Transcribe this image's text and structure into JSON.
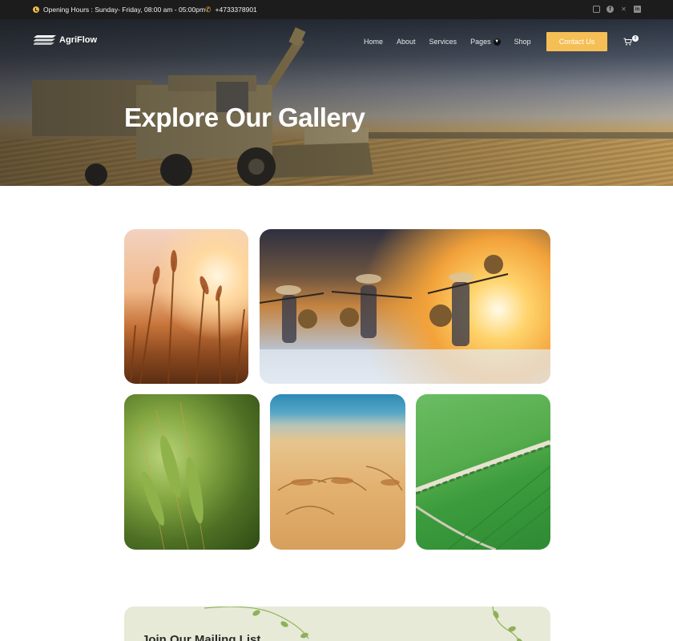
{
  "topbar": {
    "hours_icon": "clock-icon",
    "hours": "Opening Hours : Sunday- Friday, 08:00 am - 05:00pm",
    "phone_icon": "phone-icon",
    "phone": "+4733378901",
    "socials": [
      "instagram-icon",
      "facebook-icon",
      "x-icon",
      "linkedin-icon"
    ]
  },
  "nav": {
    "logo": "AgriFlow",
    "menu": [
      "Home",
      "About",
      "Services",
      "Pages",
      "Shop"
    ],
    "contact_label": "Contact Us",
    "cart_count": "0"
  },
  "hero": {
    "title": "Explore Our Gallery"
  },
  "gallery": {
    "images": [
      "wheat-sunset-photo",
      "farmers-harvest-photo",
      "green-wheat-photo",
      "golden-wheat-photo",
      "green-field-aerial-photo"
    ]
  },
  "mailing": {
    "title": "Join Our Mailing List"
  },
  "colors": {
    "accent": "#f6bf55",
    "topbar": "#1c1c1c",
    "mailing_bg": "#e6ead7"
  }
}
